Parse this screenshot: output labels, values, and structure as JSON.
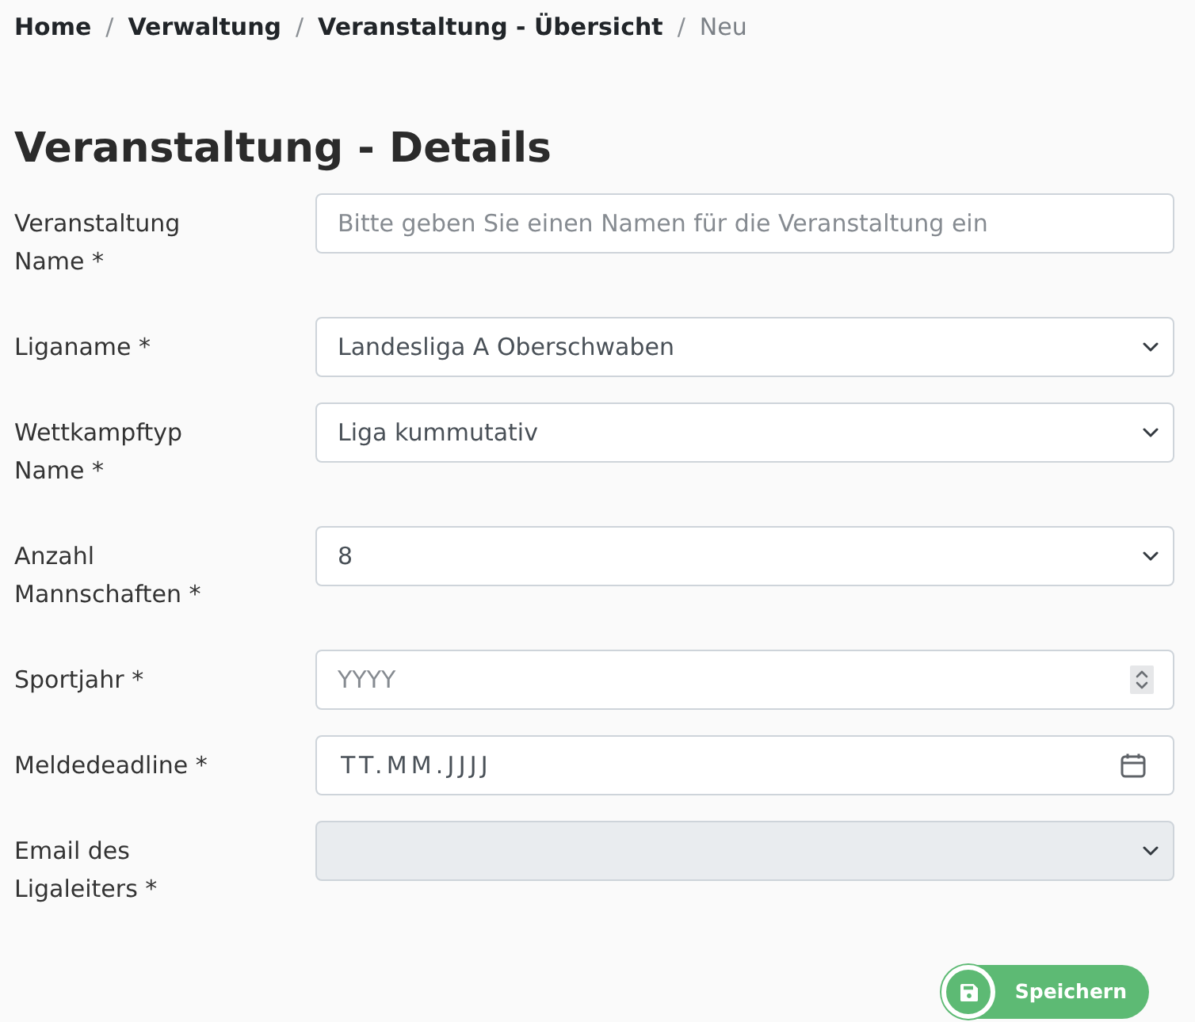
{
  "breadcrumb": [
    {
      "label": "Home",
      "current": false
    },
    {
      "separator": "/",
      "label": "Verwaltung",
      "current": false
    },
    {
      "separator": "/",
      "label": "Veranstaltung - Übersicht",
      "current": false
    },
    {
      "separator": "/",
      "label": "Neu",
      "current": true
    }
  ],
  "heading": "Veranstaltung - Details",
  "fields": [
    {
      "label": "Veranstaltung Name *",
      "kind": "text",
      "placeholder": "Bitte geben Sie einen Namen für die Veranstaltung ein",
      "disabled": false
    },
    {
      "label": "Liganame *",
      "kind": "select",
      "value": "Landesliga A Oberschwaben",
      "disabled": false
    },
    {
      "label": "Wettkampftyp Name *",
      "kind": "select",
      "value": "Liga kummutativ",
      "disabled": false
    },
    {
      "label": "Anzahl Mannschaften *",
      "kind": "select",
      "value": "8",
      "disabled": false
    },
    {
      "label": "Sportjahr *",
      "kind": "number",
      "placeholder": "YYYY",
      "disabled": false
    },
    {
      "label": "Meldedeadline *",
      "kind": "date",
      "value": "TT.MM.JJJJ",
      "disabled": false
    },
    {
      "label": "Email des Ligaleiters *",
      "kind": "select",
      "disabled": true
    }
  ],
  "save_button": {
    "label": "Speichern"
  }
}
